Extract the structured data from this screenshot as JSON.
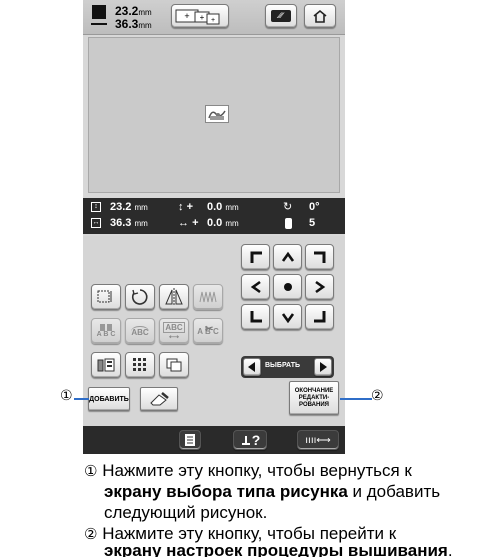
{
  "topbar": {
    "width_label": "23.2",
    "height_label": "36.3",
    "unit": "mm",
    "plus1": "+",
    "plus2": "+",
    "plus3": "+"
  },
  "info": {
    "width": "23.2",
    "height": "36.3",
    "unit": "mm",
    "offset_y": "0.0",
    "offset_x": "0.0",
    "offset_unit": "mm",
    "offset_y_prefix": "+",
    "offset_x_prefix": "+",
    "rotation": "0°",
    "colors": "5"
  },
  "panel": {
    "abc1": "A B C",
    "abc2": "ABC",
    "abc3": "ABC",
    "abc4": "A B C",
    "select_label": "ВЫБРАТЬ"
  },
  "actions": {
    "add_label": "ДОБАВИТЬ",
    "finish_label": "ОКОНЧАНИЕ РЕДАКТИ- РОВАНИЯ"
  },
  "bottom": {
    "help": "?"
  },
  "callouts": {
    "one": "①",
    "two": "②"
  },
  "captions": [
    {
      "num": "①",
      "pre": "Нажмите эту кнопку, чтобы вернуться к",
      "bold": "экрану выбора типа рисунка",
      "post": " и добавить",
      "line3": "следующий рисунок."
    },
    {
      "num": "②",
      "pre": "Нажмите эту кнопку, чтобы перейти к",
      "bold": "экрану настроек процедуры вышивания",
      "post": "."
    }
  ],
  "colors": {
    "accent": "#2f6ec8"
  }
}
